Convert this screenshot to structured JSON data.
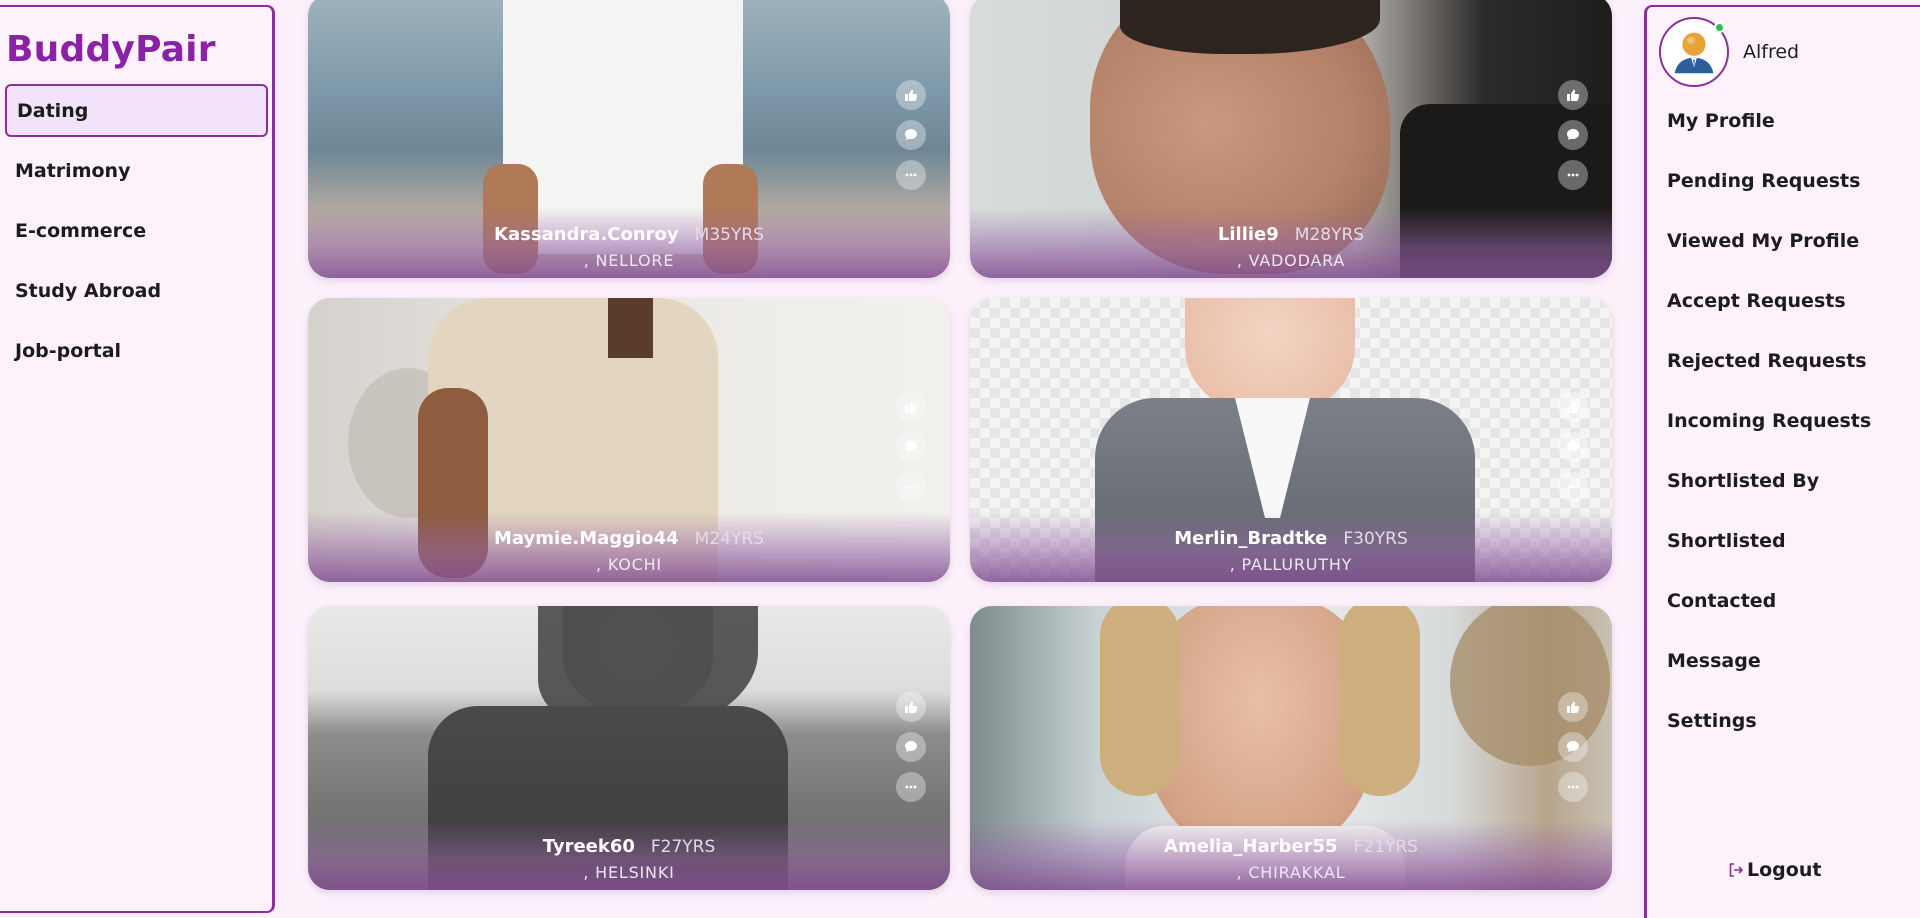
{
  "brand": "BuddyPair",
  "left_nav": [
    "Dating",
    "Matrimony",
    "E-commerce",
    "Study Abroad",
    "Job-portal"
  ],
  "active_nav": "Dating",
  "profiles": [
    {
      "name": "Kassandra.Conroy",
      "meta": "M35YRS",
      "location": ", NELLORE"
    },
    {
      "name": "Lillie9",
      "meta": "M28YRS",
      "location": ", VADODARA"
    },
    {
      "name": "Maymie.Maggio44",
      "meta": "M24YRS",
      "location": ", KOCHI"
    },
    {
      "name": "Merlin_Bradtke",
      "meta": "F30YRS",
      "location": ", PALLURUTHY"
    },
    {
      "name": "Tyreek60",
      "meta": "F27YRS",
      "location": ", HELSINKI"
    },
    {
      "name": "Amelia_Harber55",
      "meta": "F21YRS",
      "location": ", CHIRAKKAL"
    }
  ],
  "user": {
    "name": "Alfred",
    "online": true
  },
  "right_menu": [
    "My Profile",
    "Pending Requests",
    "Viewed My Profile",
    "Accept Requests",
    "Rejected Requests",
    "Incoming Requests",
    "Shortlisted By",
    "Shortlisted",
    "Contacted",
    "Message",
    "Settings"
  ],
  "logout_label": "Logout",
  "icons": [
    "thumbs-up-icon",
    "comment-icon",
    "more-icon",
    "logout-icon",
    "user-avatar-icon"
  ],
  "colors": {
    "brand": "#8a22a6",
    "border": "#8a2f9c",
    "background": "#fcf1fb",
    "online": "#2fbf4a"
  }
}
